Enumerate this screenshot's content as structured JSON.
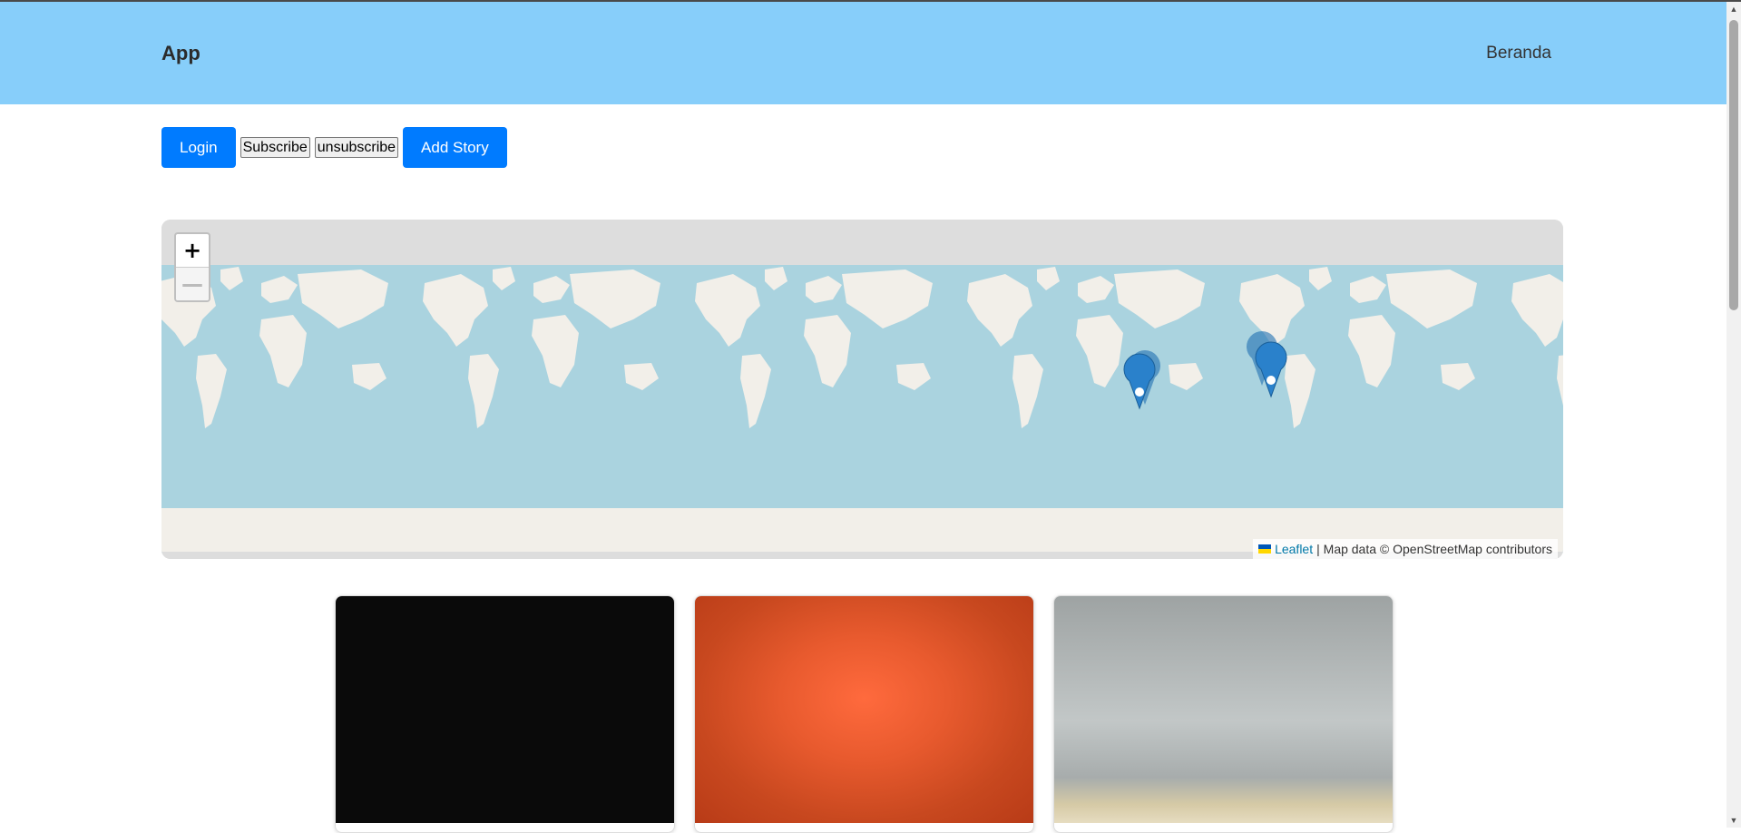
{
  "app": {
    "brand": "App"
  },
  "nav": {
    "home_label": "Beranda"
  },
  "toolbar": {
    "login_label": "Login",
    "subscribe_label": "Subscribe",
    "unsubscribe_label": "unsubscribe",
    "add_story_label": "Add Story"
  },
  "map": {
    "zoom_in": "+",
    "zoom_out": "—",
    "attribution_link": "Leaflet",
    "attribution_text": "| Map data © OpenStreetMap contributors",
    "marker_color": "#2a81cb",
    "water_color": "#aad3df",
    "land_color": "#f2efe9"
  },
  "stories": [
    {
      "image": "dark-photo"
    },
    {
      "image": "orange-photo"
    },
    {
      "image": "grey-wall-photo"
    }
  ]
}
